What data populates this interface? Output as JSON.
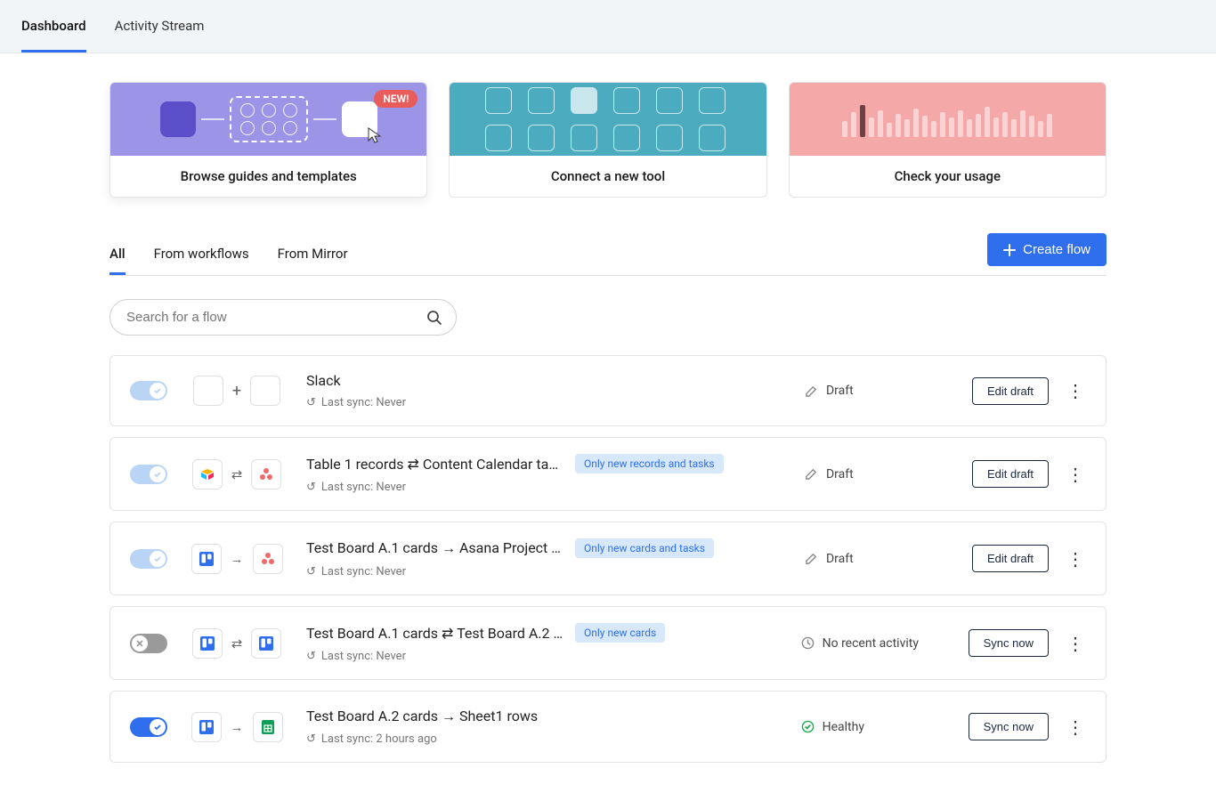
{
  "top_tabs": {
    "dashboard": "Dashboard",
    "activity": "Activity Stream"
  },
  "promo": {
    "new_badge": "NEW!",
    "browse": "Browse guides and templates",
    "connect": "Connect a new tool",
    "usage": "Check your usage"
  },
  "filter_tabs": {
    "all": "All",
    "workflows": "From workflows",
    "mirror": "From Mirror"
  },
  "create_label": "Create flow",
  "search_placeholder": "Search for a flow",
  "sync_prefix": "Last sync:",
  "actions": {
    "edit_draft": "Edit draft",
    "sync_now": "Sync now"
  },
  "statuses": {
    "draft": "Draft",
    "no_activity": "No recent activity",
    "healthy": "Healthy"
  },
  "flows": [
    {
      "title": "Slack",
      "badge": "",
      "last_sync": "Never",
      "status_key": "draft",
      "toggle_state": "draft",
      "action_key": "edit_draft",
      "left_icon": "blank",
      "connector": "plus",
      "right_icon": "blank"
    },
    {
      "title": "Table 1 records ⇄ Content Calendar tas…",
      "badge": "Only new records and tasks",
      "last_sync": "Never",
      "status_key": "draft",
      "toggle_state": "draft",
      "action_key": "edit_draft",
      "left_icon": "airtable",
      "connector": "two-way",
      "right_icon": "asana"
    },
    {
      "title": "Test Board A.1 cards → Asana Project t…",
      "badge": "Only new cards and tasks",
      "last_sync": "Never",
      "status_key": "draft",
      "toggle_state": "draft",
      "action_key": "edit_draft",
      "left_icon": "trello",
      "connector": "one-way",
      "right_icon": "asana"
    },
    {
      "title": "Test Board A.1 cards ⇄ Test Board A.2 c…",
      "badge": "Only new cards",
      "last_sync": "Never",
      "status_key": "no_activity",
      "toggle_state": "off",
      "action_key": "sync_now",
      "left_icon": "trello",
      "connector": "two-way",
      "right_icon": "trello"
    },
    {
      "title": "Test Board A.2 cards → Sheet1 rows",
      "badge": "",
      "last_sync": "2 hours ago",
      "status_key": "healthy",
      "toggle_state": "on",
      "action_key": "sync_now",
      "left_icon": "trello",
      "connector": "one-way",
      "right_icon": "sheets"
    }
  ]
}
